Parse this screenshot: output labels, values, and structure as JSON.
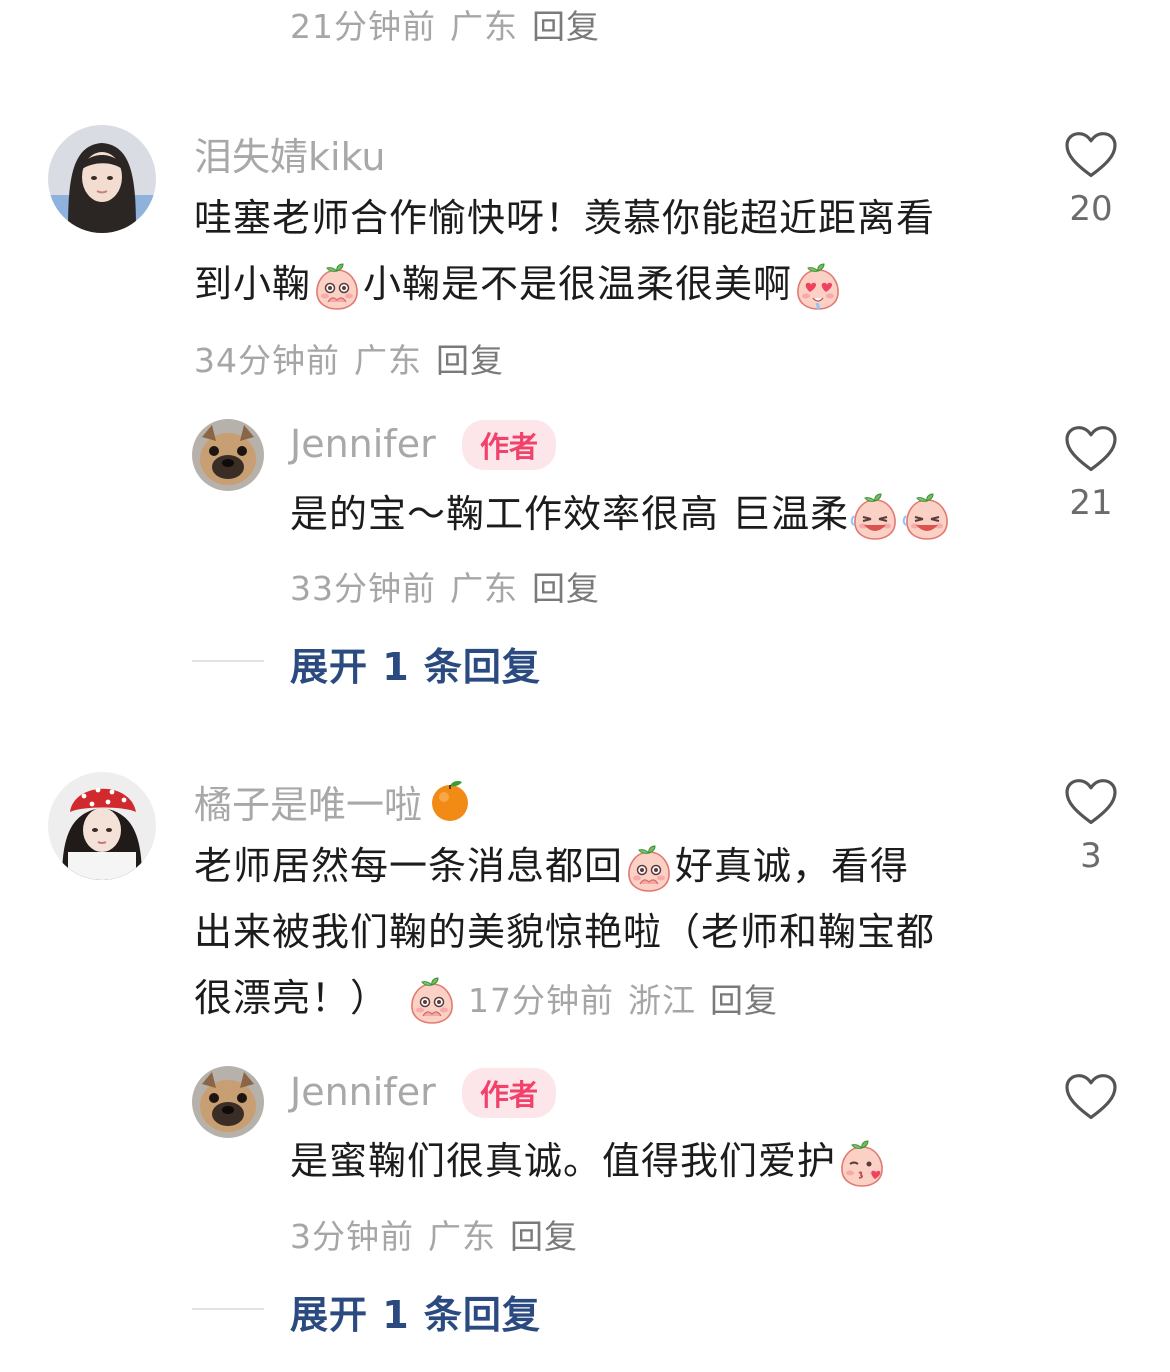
{
  "top_meta": {
    "time": "21分钟前",
    "location": "广东",
    "reply": "回复"
  },
  "comments": [
    {
      "username": "泪失婧kiku",
      "likes": "20",
      "line1": "哇塞老师合作愉快呀！羡慕你能超近距离看",
      "line2_a": "到小鞠",
      "line2_b": "小鞠是不是很温柔很美啊",
      "time": "34分钟前",
      "location": "广东",
      "reply": "回复",
      "replies": [
        {
          "username": "Jennifer",
          "badge": "作者",
          "likes": "21",
          "text": "是的宝～鞠工作效率很高 巨温柔",
          "time": "33分钟前",
          "location": "广东",
          "reply": "回复"
        }
      ],
      "expand": "展开 1 条回复"
    },
    {
      "username": "橘子是唯一啦",
      "username_emoji": "orange-emoji",
      "likes": "3",
      "line1_a": "老师居然每一条消息都回",
      "line1_b": "好真诚，看得",
      "line2": "出来被我们鞠的美貌惊艳啦（老师和鞠宝都",
      "line3": "很漂亮！）",
      "time": "17分钟前",
      "location": "浙江",
      "reply": "回复",
      "replies": [
        {
          "username": "Jennifer",
          "badge": "作者",
          "likes": "",
          "text": "是蜜鞠们很真诚。值得我们爱护",
          "time": "3分钟前",
          "location": "广东",
          "reply": "回复"
        }
      ],
      "expand": "展开 1 条回复"
    }
  ],
  "colors": {
    "username": "#a8a8a8",
    "meta": "#a6a6a6",
    "expand": "#2a4a80",
    "badge_bg": "#fde6ea",
    "badge_text": "#f2416b"
  },
  "icons": {
    "like": "heart-outline-icon",
    "emoji_shy": "peach-shy-emoji",
    "emoji_love": "peach-heart-eyes-emoji",
    "emoji_laugh": "peach-laugh-emoji",
    "emoji_kiss": "peach-kiss-emoji"
  }
}
